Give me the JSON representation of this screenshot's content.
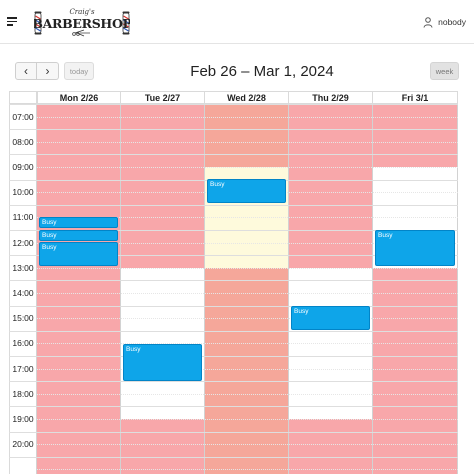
{
  "header": {
    "logo": {
      "top_script": "Craig's",
      "name": "BARBERSHOP"
    },
    "user_name": "nobody"
  },
  "toolbar": {
    "prev_label": "‹",
    "next_label": "›",
    "today_label": "today",
    "title": "Feb 26 – Mar 1, 2024",
    "week_label": "week"
  },
  "calendar": {
    "time_labels": [
      "07:00",
      "08:00",
      "09:00",
      "10:00",
      "11:00",
      "12:00",
      "13:00",
      "14:00",
      "15:00",
      "16:00",
      "17:00",
      "18:00",
      "19:00",
      "20:00"
    ],
    "days": [
      {
        "label": "Mon 2/26"
      },
      {
        "label": "Tue 2/27"
      },
      {
        "label": "Wed 2/28"
      },
      {
        "label": "Thu 2/29"
      },
      {
        "label": "Fri 3/1"
      }
    ],
    "event_label": "Busy",
    "colors": {
      "unavailable": "#f8a7aa",
      "unavailable_today": "#f5a79a",
      "today_available": "#fefadc",
      "available": "#ffffff",
      "event": "#0ea5e9"
    }
  }
}
